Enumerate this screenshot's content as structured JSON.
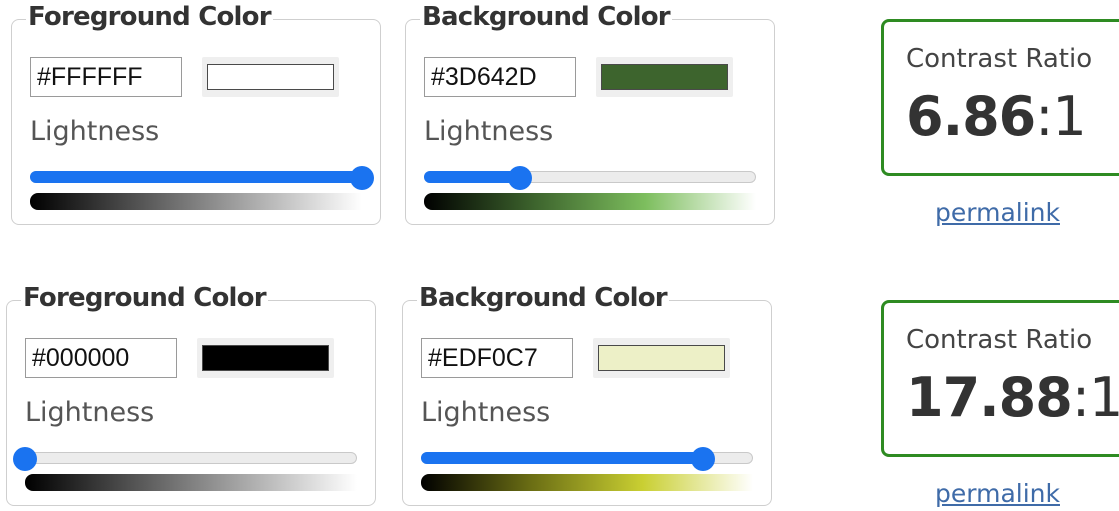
{
  "checkers": [
    {
      "foreground": {
        "title": "Foreground Color",
        "hex": "#FFFFFF",
        "swatch_color": "#FFFFFF",
        "lightness_label": "Lightness",
        "lightness_value": 1.0,
        "gradient": [
          "#000000",
          "#FFFFFF"
        ]
      },
      "background": {
        "title": "Background Color",
        "hex": "#3D642D",
        "swatch_color": "#3D642D",
        "lightness_label": "Lightness",
        "lightness_value": 0.29,
        "gradient": [
          "#000000",
          "#3D642D",
          "#7DBE5E",
          "#FFFFFF"
        ]
      },
      "contrast": {
        "caption": "Contrast Ratio",
        "value": "6.86",
        "separator": ":1",
        "border_color": "#2E8B22"
      },
      "permalink_label": "permalink"
    },
    {
      "foreground": {
        "title": "Foreground Color",
        "hex": "#000000",
        "swatch_color": "#000000",
        "lightness_label": "Lightness",
        "lightness_value": 0.0,
        "gradient": [
          "#000000",
          "#FFFFFF"
        ]
      },
      "background": {
        "title": "Background Color",
        "hex": "#EDF0C7",
        "swatch_color": "#EDF0C7",
        "lightness_label": "Lightness",
        "lightness_value": 0.85,
        "gradient": [
          "#000000",
          "#6B6E14",
          "#C9CF32",
          "#FFFFFF"
        ]
      },
      "contrast": {
        "caption": "Contrast Ratio",
        "value": "17.88",
        "separator": ":1",
        "border_color": "#2E8B22"
      },
      "permalink_label": "permalink"
    }
  ],
  "colors": {
    "slider_accent": "#1A73F0",
    "link": "#3F6BA8"
  }
}
